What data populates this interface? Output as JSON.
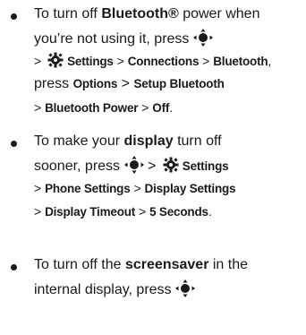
{
  "tips": [
    {
      "l1": {
        "pre": "To turn off ",
        "bold": "Bluetooth®",
        "post": " power when"
      },
      "l2": {
        "pre": "you’re not using it, press"
      },
      "l3": {
        "sep1": ">",
        "settings": "Settings",
        "sep2": ">",
        "conn": "Connections",
        "sep3": ">",
        "bt": "Bluetooth",
        "post": ","
      },
      "l4": {
        "pre": "press ",
        "options": "Options",
        "sep": ">",
        "setup": "Setup Bluetooth"
      },
      "l5": {
        "sep1": ">",
        "power": "Bluetooth Power",
        "sep2": ">",
        "off": "Off",
        "post": "."
      }
    },
    {
      "l1": {
        "pre": "To make your ",
        "bold": "display",
        "post": " turn off"
      },
      "l2": {
        "pre": "sooner, press",
        "sep": ">",
        "settings": "Settings"
      },
      "l3": {
        "sep1": ">",
        "phone": "Phone Settings",
        "sep2": ">",
        "disp": "Display Settings"
      },
      "l4": {
        "sep1": ">",
        "timeout": "Display Timeout",
        "sep2": ">",
        "secs": "5 Seconds",
        "post": "."
      }
    },
    {
      "l1": {
        "pre": "To turn off the ",
        "bold": "screensaver",
        "post": " in the"
      },
      "l2": {
        "pre": "internal display, press"
      }
    }
  ],
  "icons": {
    "nav_key": "navigation-key-icon",
    "settings": "settings-gear-icon"
  }
}
